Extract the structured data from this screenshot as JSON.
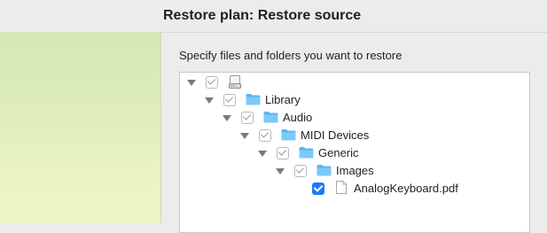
{
  "header": {
    "title": "Restore plan: Restore source"
  },
  "content": {
    "instruction": "Specify files and folders you want to restore"
  },
  "tree": {
    "items": [
      {
        "label": "",
        "icon": "drive-icon",
        "checked": false,
        "level": 0
      },
      {
        "label": "Library",
        "icon": "folder-icon",
        "checked": false,
        "level": 1
      },
      {
        "label": "Audio",
        "icon": "folder-icon",
        "checked": false,
        "level": 2
      },
      {
        "label": "MIDI Devices",
        "icon": "folder-icon",
        "checked": false,
        "level": 3
      },
      {
        "label": "Generic",
        "icon": "folder-icon",
        "checked": false,
        "level": 4
      },
      {
        "label": "Images",
        "icon": "folder-icon",
        "checked": false,
        "level": 5
      },
      {
        "label": "AnalogKeyboard.pdf",
        "icon": "file-icon",
        "checked": true,
        "level": 6
      }
    ]
  },
  "colors": {
    "accent": "#1a7cf5",
    "folder": "#5bb5f0",
    "sidebar": "#dcecb9"
  }
}
